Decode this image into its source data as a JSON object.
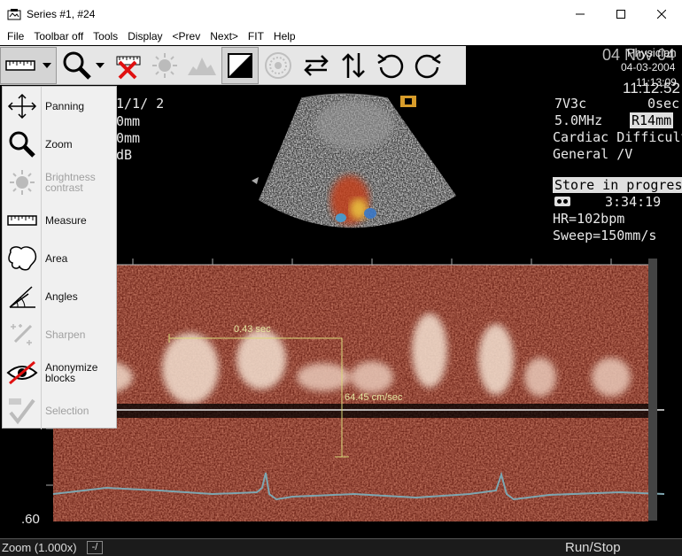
{
  "window": {
    "title": "Series #1, #24"
  },
  "menu": [
    "File",
    "Toolbar off",
    "Tools",
    "Display",
    "<Prev",
    "Next>",
    "FIT",
    "Help"
  ],
  "toolbar": {
    "icons": [
      "ruler-icon",
      "zoom-icon",
      "clear-measure-icon",
      "brightness-icon",
      "histogram-icon",
      "invert-icon",
      "pattern-icon",
      "flip-horizontal-icon",
      "flip-vertical-icon",
      "rotate-left-icon",
      "rotate-right-icon"
    ]
  },
  "tool_menu": [
    {
      "label": "Panning",
      "icon": "pan-icon",
      "enabled": true
    },
    {
      "label": "Zoom",
      "icon": "zoom-icon",
      "enabled": true
    },
    {
      "label": "Brightness contrast",
      "icon": "brightness-icon",
      "enabled": false
    },
    {
      "label": "Measure",
      "icon": "ruler-icon",
      "enabled": true
    },
    {
      "label": "Area",
      "icon": "area-icon",
      "enabled": true
    },
    {
      "label": "Angles",
      "icon": "angle-icon",
      "enabled": true
    },
    {
      "label": "Sharpen",
      "icon": "wand-icon",
      "enabled": false
    },
    {
      "label": "Anonymize blocks",
      "icon": "anonymize-icon",
      "enabled": true
    },
    {
      "label": "Selection",
      "icon": "selection-icon",
      "enabled": false
    }
  ],
  "overlay": {
    "top_right_date_big": "04 Nov 04",
    "physician": "Physician",
    "date": "04-03-2004",
    "time_small": "11:13:09",
    "time_big": "11:12:52",
    "left_info": [
      "1/1/ 2",
      "0mm",
      "0mm",
      "dB"
    ],
    "right_info": {
      "probe": "7V3c",
      "sec": "0sec",
      "freq": "5.0MHz",
      "depth": "R14mm",
      "preset": "Cardiac Difficult",
      "mode": "General /V",
      "store": "Store in progress",
      "elapsed": "3:34:19",
      "hr": "HR=102bpm",
      "sweep": "Sweep=150mm/s"
    },
    "measure_time": "0.43 sec",
    "measure_velocity": "64.45 cm/sec",
    "scale_label": ".60"
  },
  "status": {
    "zoom": "Zoom (1.000x)",
    "arrow": "-/→",
    "run": "Run/Stop"
  },
  "colors": {
    "doppler_bg": "#7a2a1e",
    "measure": "#d9d97a",
    "menu_bg": "#f0f0f0"
  }
}
